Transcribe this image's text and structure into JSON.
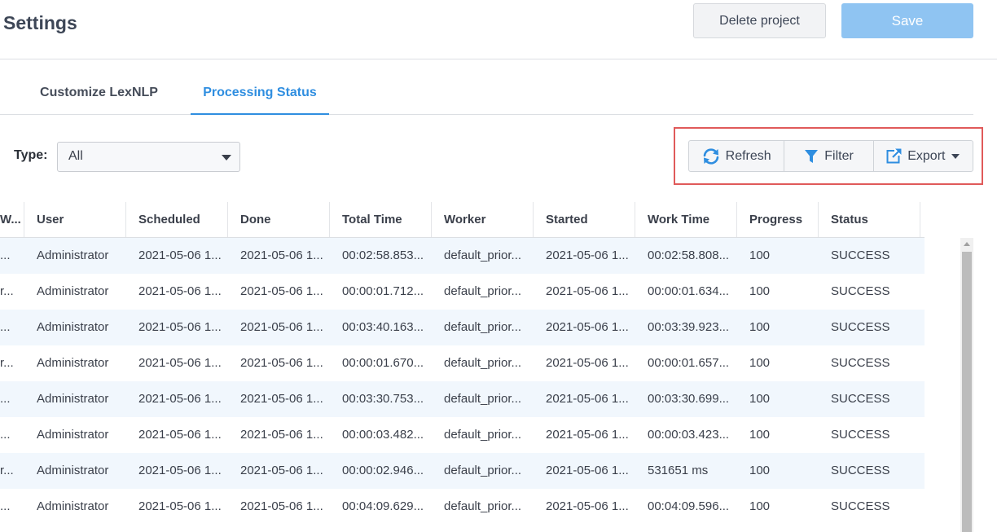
{
  "header": {
    "title": "Settings",
    "delete_label": "Delete project",
    "save_label": "Save"
  },
  "tabs": [
    {
      "label": "Customize LexNLP",
      "active": false
    },
    {
      "label": "Processing Status",
      "active": true
    }
  ],
  "filter": {
    "type_label": "Type:",
    "type_value": "All"
  },
  "toolbar": {
    "refresh_label": "Refresh",
    "filter_label": "Filter",
    "export_label": "Export"
  },
  "table": {
    "columns": [
      "W...",
      "User",
      "Scheduled",
      "Done",
      "Total Time",
      "Worker",
      "Started",
      "Work Time",
      "Progress",
      "Status"
    ],
    "rows": [
      [
        "...",
        "Administrator",
        "2021-05-06 1...",
        "2021-05-06 1...",
        "00:02:58.853...",
        "default_prior...",
        "2021-05-06 1...",
        "00:02:58.808...",
        "100",
        "SUCCESS"
      ],
      [
        "r...",
        "Administrator",
        "2021-05-06 1...",
        "2021-05-06 1...",
        "00:00:01.712...",
        "default_prior...",
        "2021-05-06 1...",
        "00:00:01.634...",
        "100",
        "SUCCESS"
      ],
      [
        "...",
        "Administrator",
        "2021-05-06 1...",
        "2021-05-06 1...",
        "00:03:40.163...",
        "default_prior...",
        "2021-05-06 1...",
        "00:03:39.923...",
        "100",
        "SUCCESS"
      ],
      [
        "r...",
        "Administrator",
        "2021-05-06 1...",
        "2021-05-06 1...",
        "00:00:01.670...",
        "default_prior...",
        "2021-05-06 1...",
        "00:00:01.657...",
        "100",
        "SUCCESS"
      ],
      [
        "...",
        "Administrator",
        "2021-05-06 1...",
        "2021-05-06 1...",
        "00:03:30.753...",
        "default_prior...",
        "2021-05-06 1...",
        "00:03:30.699...",
        "100",
        "SUCCESS"
      ],
      [
        "...",
        "Administrator",
        "2021-05-06 1...",
        "2021-05-06 1...",
        "00:00:03.482...",
        "default_prior...",
        "2021-05-06 1...",
        "00:00:03.423...",
        "100",
        "SUCCESS"
      ],
      [
        "r...",
        "Administrator",
        "2021-05-06 1...",
        "2021-05-06 1...",
        "00:00:02.946...",
        "default_prior...",
        "2021-05-06 1...",
        "531651 ms",
        "100",
        "SUCCESS"
      ],
      [
        "...",
        "Administrator",
        "2021-05-06 1...",
        "2021-05-06 1...",
        "00:04:09.629...",
        "default_prior...",
        "2021-05-06 1...",
        "00:04:09.596...",
        "100",
        "SUCCESS"
      ]
    ]
  },
  "colors": {
    "accent": "#2f8ee0",
    "save_button": "#8fc4f2",
    "highlight_box": "#e05a5a",
    "row_stripe": "#f1f7fd"
  }
}
